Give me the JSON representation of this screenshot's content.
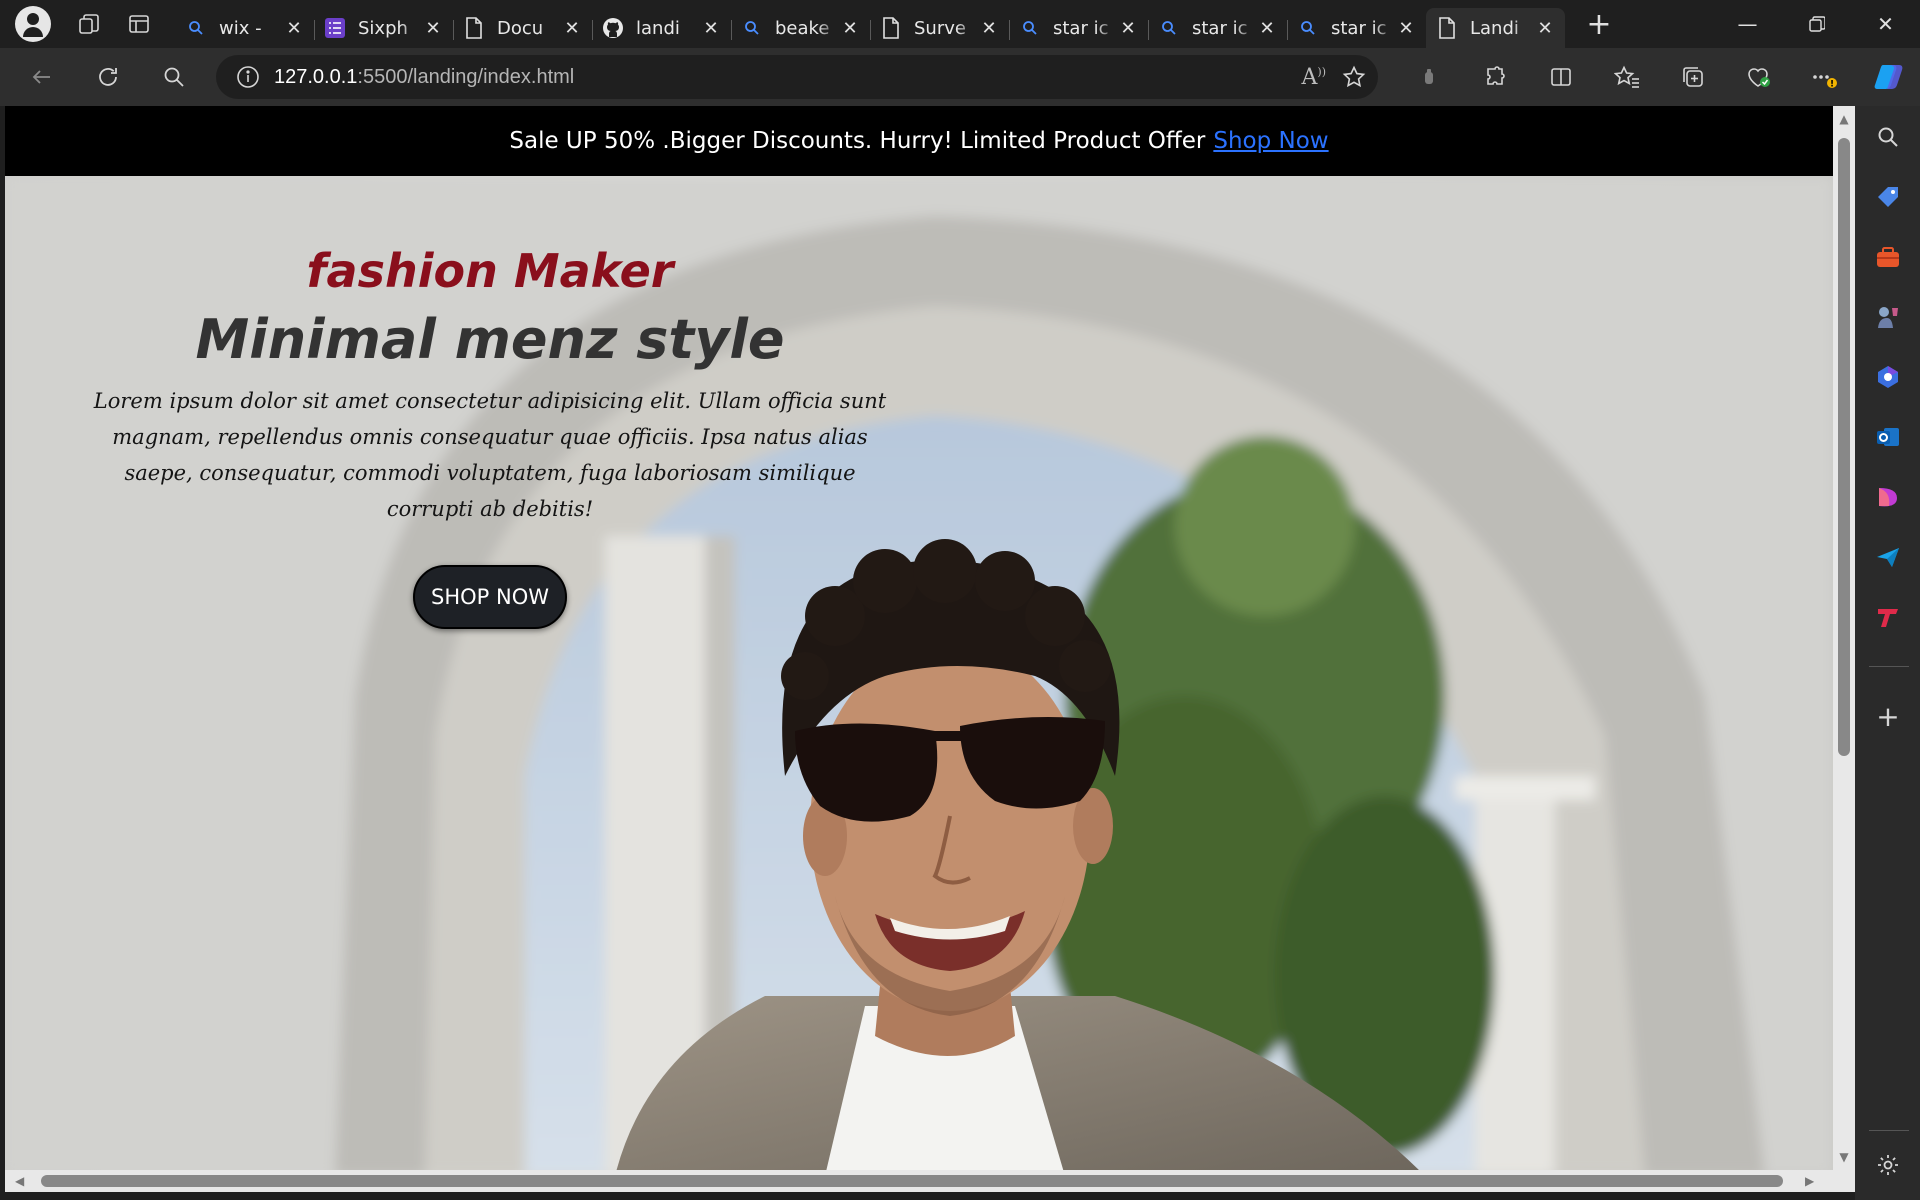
{
  "browser": {
    "tabs": [
      {
        "label": "wix -",
        "icon": "search-icon"
      },
      {
        "label": "Sixph",
        "icon": "list-icon"
      },
      {
        "label": "Docu",
        "icon": "document-icon"
      },
      {
        "label": "landi",
        "icon": "github-icon"
      },
      {
        "label": "beake",
        "icon": "search-icon"
      },
      {
        "label": "Surve",
        "icon": "document-icon"
      },
      {
        "label": "star ic",
        "icon": "search-icon"
      },
      {
        "label": "star ic",
        "icon": "search-icon"
      },
      {
        "label": "star ic",
        "icon": "search-icon"
      },
      {
        "label": "Landi",
        "icon": "document-icon",
        "active": true
      }
    ],
    "url": {
      "host": "127.0.0.1",
      "rest": ":5500/landing/index.html"
    },
    "colors": {
      "accent": "#2b72ff",
      "tab_bg": "#1f1f1f",
      "toolbar_bg": "#2e2e2e"
    }
  },
  "page": {
    "promo_text": "Sale UP 50% .Bigger Discounts. Hurry! Limited Product Offer",
    "promo_link": "Shop Now",
    "brand": "fashion Maker",
    "headline": "Minimal menz style",
    "description": "Lorem ipsum dolor sit amet consectetur adipisicing elit. Ullam officia sunt magnam, repellendus omnis consequatur quae officiis. Ipsa natus alias saepe, consequatur, commodi voluptatem, fuga laboriosam similique corrupti ab debitis!",
    "cta": "SHOP NOW",
    "colors": {
      "brand": "#8a0f1c",
      "button": "#1e2126"
    }
  },
  "sidebar": [
    "search-icon",
    "tag-icon",
    "briefcase-icon",
    "games-icon",
    "copilot-icon",
    "outlook-icon",
    "designer-icon",
    "send-icon",
    "typeface-icon",
    "add-icon",
    "settings-icon"
  ]
}
